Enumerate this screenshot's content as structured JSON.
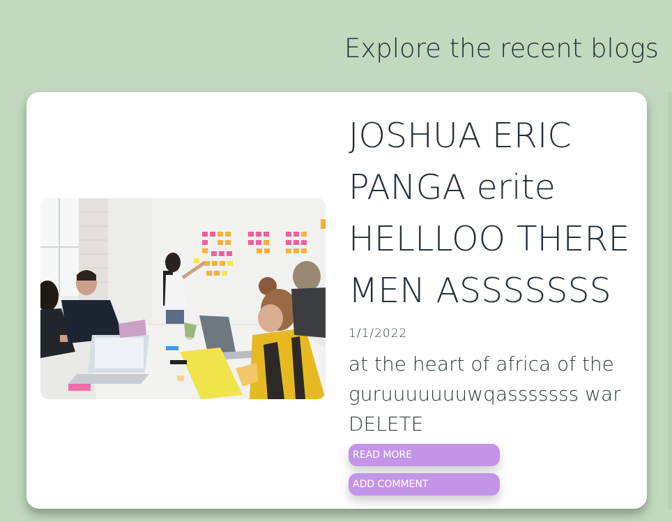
{
  "section": {
    "title": "Explore the recent blogs"
  },
  "post": {
    "title": "JOSHUA ERIC PANGA erite HELLLOO THERE MEN ASSSSSSS",
    "date": "1/1/2022",
    "excerpt": "at the heart of africa of the guruuuuuuuwqasssssss war DELETE",
    "read_more_label": "READ MORE",
    "add_comment_label": "ADD COMMENT",
    "image_alt": "team meeting with sticky notes on whiteboard"
  },
  "colors": {
    "background": "#c1d9be",
    "card": "#ffffff",
    "button": "#c394e8",
    "text": "#253038"
  }
}
